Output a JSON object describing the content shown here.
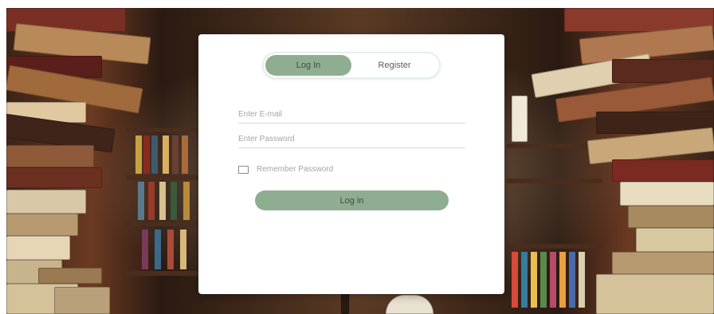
{
  "auth_card": {
    "tabs": {
      "login_label": "Log In",
      "register_label": "Register"
    },
    "email": {
      "placeholder": "Enter E-mail",
      "value": ""
    },
    "password": {
      "placeholder": "Enter Password",
      "value": ""
    },
    "remember_label": "Remember Password",
    "remember_checked": false,
    "submit_label": "Log in"
  },
  "colors": {
    "accent": "#8fae91",
    "card_background": "#ffffff"
  }
}
